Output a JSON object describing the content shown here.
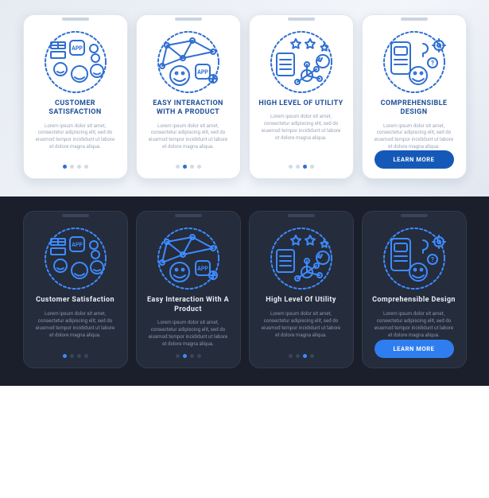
{
  "lorem": "Lorem ipsum dolor sit amet, consectetur adipiscing elit, sed do eiusmod tempor incididunt ut labore et dolore magna aliqua.",
  "cta": "LEARN MORE",
  "light": {
    "slides": [
      {
        "title": "CUSTOMER SATISFACTION"
      },
      {
        "title": "EASY INTERACTION WITH A PRODUCT"
      },
      {
        "title": "HIGH LEVEL OF UTILITY"
      },
      {
        "title": "COMPREHENSIBLE DESIGN"
      }
    ]
  },
  "dark": {
    "slides": [
      {
        "title": "Customer Satisfaction"
      },
      {
        "title": "Easy Interaction With A Product"
      },
      {
        "title": "High Level Of Utility"
      },
      {
        "title": "Comprehensible Design"
      }
    ]
  }
}
